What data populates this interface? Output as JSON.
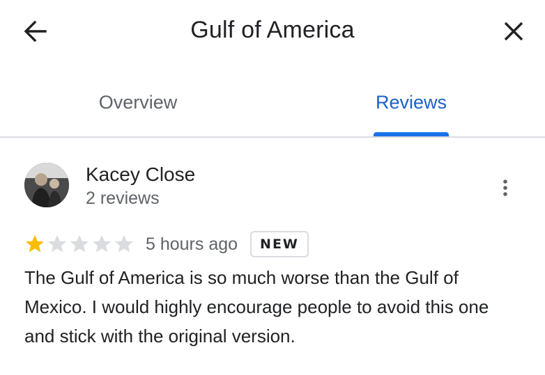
{
  "header": {
    "title": "Gulf of America",
    "back_icon": "arrow-left-icon",
    "close_icon": "close-icon"
  },
  "tabs": [
    {
      "label": "Overview",
      "active": false
    },
    {
      "label": "Reviews",
      "active": true
    }
  ],
  "colors": {
    "accent": "#1a73e8",
    "star_filled": "#fbbc04",
    "star_empty": "#dadce0"
  },
  "review": {
    "author": "Kacey Close",
    "author_review_count": "2 reviews",
    "rating": 1,
    "rating_max": 5,
    "time": "5 hours ago",
    "badge": "NEW",
    "text": "The Gulf of America is so much worse than the Gulf of Mexico. I would highly encourage people to avoid this one and stick with the original version.",
    "more_icon": "more-vert-icon"
  }
}
